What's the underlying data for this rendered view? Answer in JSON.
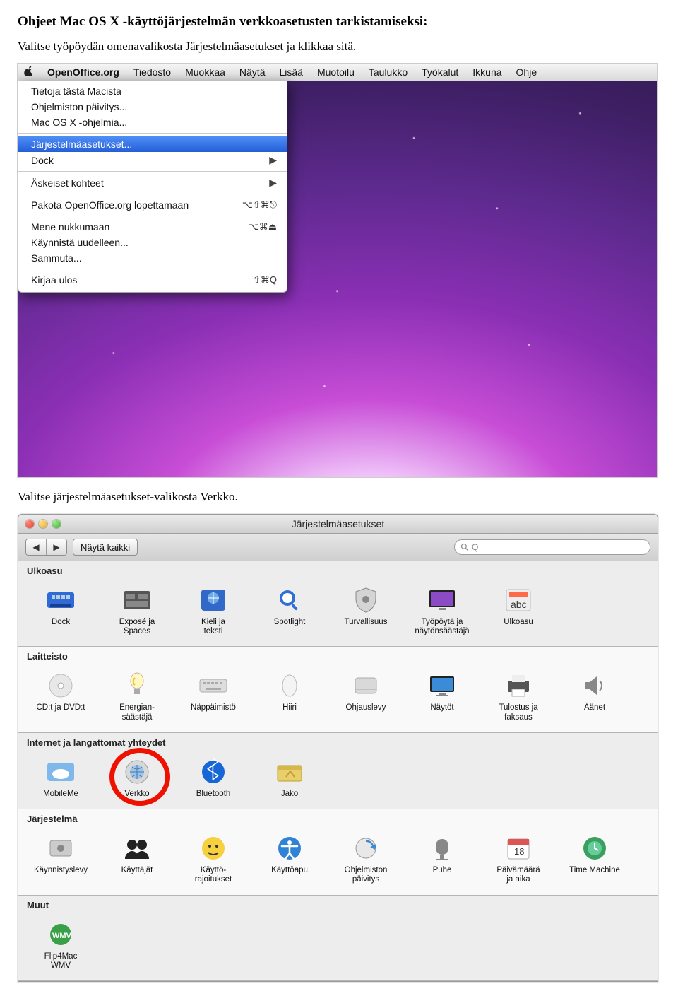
{
  "doc": {
    "title": "Ohjeet Mac OS X -käyttöjärjestelmän verkkoasetusten tarkistamiseksi:",
    "step1": "Valitse työpöydän omenavalikosta Järjestelmäasetukset ja klikkaa sitä.",
    "step2": "Valitse järjestelmäasetukset-valikosta Verkko."
  },
  "menubar": {
    "app": "OpenOffice.org",
    "items": [
      "Tiedosto",
      "Muokkaa",
      "Näytä",
      "Lisää",
      "Muotoilu",
      "Taulukko",
      "Työkalut",
      "Ikkuna",
      "Ohje"
    ]
  },
  "dropdown": {
    "items": [
      {
        "label": "Tietoja tästä Macista"
      },
      {
        "label": "Ohjelmiston päivitys..."
      },
      {
        "label": "Mac OS X -ohjelmia..."
      },
      {
        "sep": true
      },
      {
        "label": "Järjestelmäasetukset...",
        "highlight": true
      },
      {
        "label": "Dock",
        "submenu": true
      },
      {
        "sep": true
      },
      {
        "label": "Äskeiset kohteet",
        "submenu": true
      },
      {
        "sep": true
      },
      {
        "label": "Pakota OpenOffice.org lopettamaan",
        "shortcut": "⌥⇧⌘⎋"
      },
      {
        "sep": true
      },
      {
        "label": "Mene nukkumaan",
        "shortcut": "⌥⌘⏏"
      },
      {
        "label": "Käynnistä uudelleen..."
      },
      {
        "label": "Sammuta..."
      },
      {
        "sep": true
      },
      {
        "label": "Kirjaa ulos",
        "shortcut": "⇧⌘Q"
      }
    ]
  },
  "prefs": {
    "title": "Järjestelmäasetukset",
    "show_all": "Näytä kaikki",
    "search_placeholder": "Q",
    "sections": [
      {
        "name": "Ulkoasu",
        "bg": "gray",
        "items": [
          {
            "label": "Dock",
            "icon": "dock"
          },
          {
            "label": "Exposé ja\nSpaces",
            "icon": "expose"
          },
          {
            "label": "Kieli ja\nteksti",
            "icon": "lang"
          },
          {
            "label": "Spotlight",
            "icon": "spotlight"
          },
          {
            "label": "Turvallisuus",
            "icon": "security"
          },
          {
            "label": "Työpöytä ja\nnäytönsäästäjä",
            "icon": "desktop"
          },
          {
            "label": "Ulkoasu",
            "icon": "appearance"
          }
        ]
      },
      {
        "name": "Laitteisto",
        "bg": "white",
        "items": [
          {
            "label": "CD:t ja DVD:t",
            "icon": "cds"
          },
          {
            "label": "Energian-\nsäästäjä",
            "icon": "energy"
          },
          {
            "label": "Näppäimistö",
            "icon": "keyboard"
          },
          {
            "label": "Hiiri",
            "icon": "mouse"
          },
          {
            "label": "Ohjauslevy",
            "icon": "trackpad"
          },
          {
            "label": "Näytöt",
            "icon": "displays"
          },
          {
            "label": "Tulostus ja\nfaksaus",
            "icon": "print"
          },
          {
            "label": "Äänet",
            "icon": "sound"
          }
        ]
      },
      {
        "name": "Internet ja langattomat yhteydet",
        "bg": "gray",
        "items": [
          {
            "label": "MobileMe",
            "icon": "mobileme"
          },
          {
            "label": "Verkko",
            "icon": "network",
            "circled": true
          },
          {
            "label": "Bluetooth",
            "icon": "bluetooth"
          },
          {
            "label": "Jako",
            "icon": "sharing"
          }
        ]
      },
      {
        "name": "Järjestelmä",
        "bg": "white",
        "items": [
          {
            "label": "Käynnistyslevy",
            "icon": "startup"
          },
          {
            "label": "Käyttäjät",
            "icon": "users"
          },
          {
            "label": "Käyttö-\nrajoitukset",
            "icon": "parental"
          },
          {
            "label": "Käyttöapu",
            "icon": "access"
          },
          {
            "label": "Ohjelmiston\npäivitys",
            "icon": "swupdate"
          },
          {
            "label": "Puhe",
            "icon": "speech"
          },
          {
            "label": "Päivämäärä\nja aika",
            "icon": "datetime"
          },
          {
            "label": "Time Machine",
            "icon": "timemachine"
          }
        ]
      },
      {
        "name": "Muut",
        "bg": "gray",
        "items": [
          {
            "label": "Flip4Mac\nWMV",
            "icon": "flip4mac"
          }
        ]
      }
    ]
  }
}
